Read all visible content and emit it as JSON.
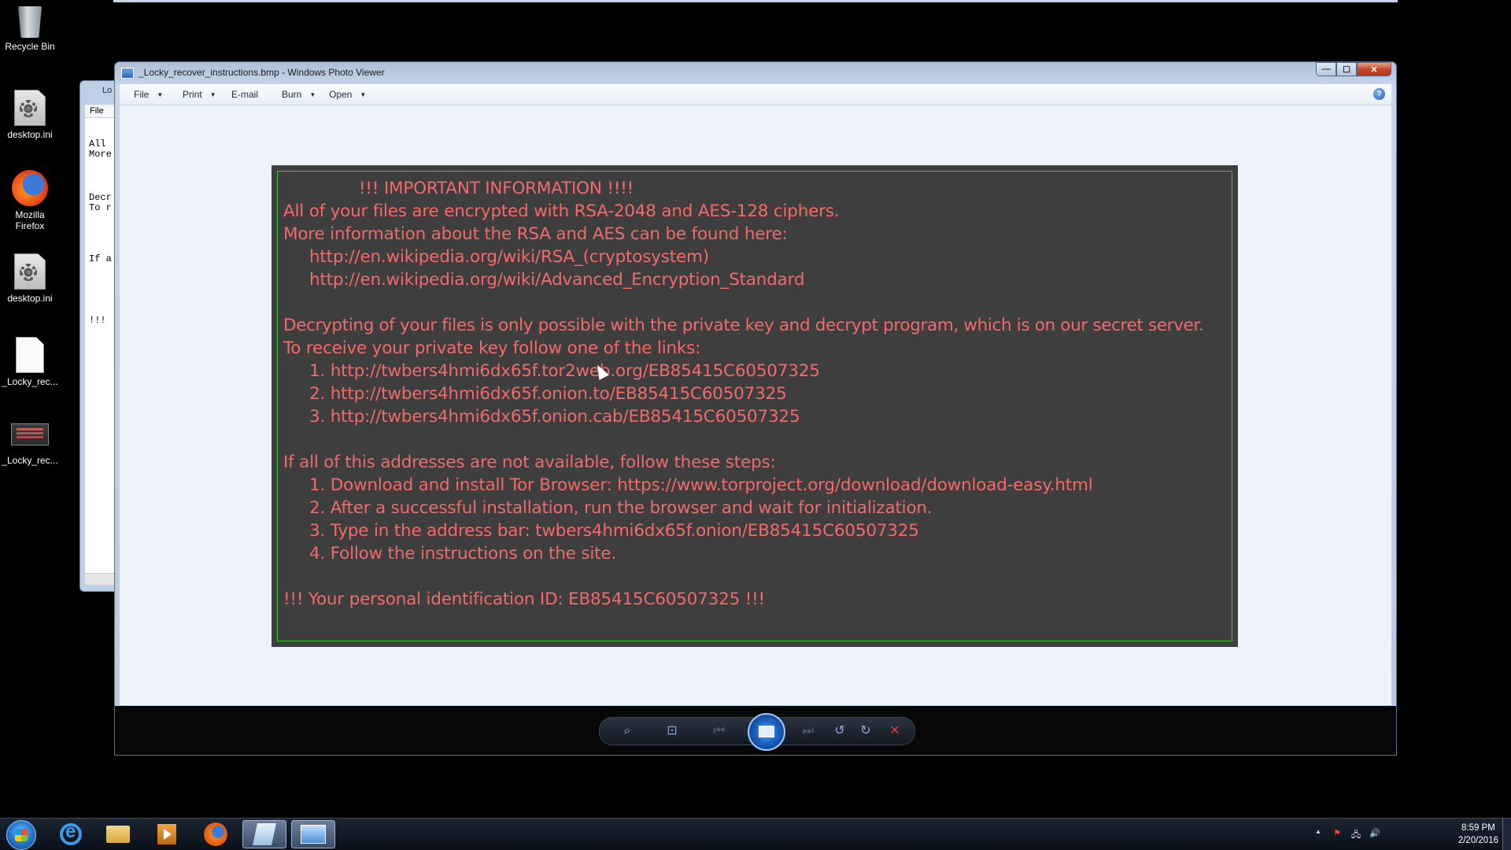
{
  "desktop": {
    "icons": [
      {
        "label": "Recycle Bin"
      },
      {
        "label": "desktop.ini"
      },
      {
        "label": "Mozilla Firefox"
      },
      {
        "label": "desktop.ini"
      },
      {
        "label": "_Locky_rec..."
      },
      {
        "label": "_Locky_rec..."
      }
    ]
  },
  "notepad": {
    "title": "Lo",
    "menu_file": "File",
    "lines": [
      "All",
      "More",
      "Decr",
      "To r",
      "If a",
      "!!!"
    ]
  },
  "viewer": {
    "title": "_Locky_recover_instructions.bmp - Windows Photo Viewer",
    "menu": {
      "file": "File",
      "print": "Print",
      "email": "E-mail",
      "burn": "Burn",
      "open": "Open"
    },
    "help": "?",
    "caption": {
      "minimize": "—",
      "maximize": "☐",
      "close": "✕"
    }
  },
  "ransom_note": {
    "heading": "!!! IMPORTANT INFORMATION !!!!",
    "p1_l1": "All of your files are encrypted with RSA-2048 and AES-128 ciphers.",
    "p1_l2": "More information about the RSA and AES can be found here:",
    "p1_link1": "http://en.wikipedia.org/wiki/RSA_(cryptosystem)",
    "p1_link2": "http://en.wikipedia.org/wiki/Advanced_Encryption_Standard",
    "p2_l1": "Decrypting of your files is only possible with the private key and decrypt program, which is on our secret server.",
    "p2_l2": "To receive your private key follow one of the links:",
    "p2_link1": "1. http://twbers4hmi6dx65f.tor2web.org/EB85415C60507325",
    "p2_link2": "2. http://twbers4hmi6dx65f.onion.to/EB85415C60507325",
    "p2_link3": "3. http://twbers4hmi6dx65f.onion.cab/EB85415C60507325",
    "p3_l1": "If all of this addresses are not available, follow these steps:",
    "p3_s1": "1. Download and install Tor Browser: https://www.torproject.org/download/download-easy.html",
    "p3_s2": "2. After a successful installation, run the browser and wait for initialization.",
    "p3_s3": "3. Type in the address bar: twbers4hmi6dx65f.onion/EB85415C60507325",
    "p3_s4": "4. Follow the instructions on the site.",
    "footer": "!!! Your personal identification ID: EB85415C60507325 !!!"
  },
  "viewer_toolbar": {
    "zoom_icon": "⌕",
    "fit_icon": "⊡",
    "prev_icon": "⏮",
    "next_icon": "⏭",
    "rotate_ccw_icon": "↺",
    "rotate_cw_icon": "↻",
    "delete_icon": "✕"
  },
  "taskbar": {
    "time": "8:59 PM",
    "date": "2/20/2016",
    "tray_icons": {
      "chevron": "▲",
      "flag": "⚑",
      "network": "🖧",
      "volume": "🔊"
    }
  },
  "colors": {
    "ransom_text": "#f26a6a",
    "ransom_bg": "#3e3e3e",
    "ransom_border": "#3bbf3b"
  }
}
